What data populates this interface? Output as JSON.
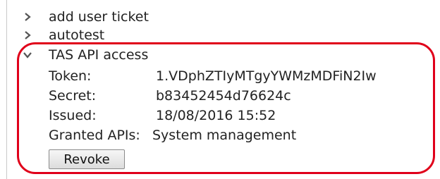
{
  "tree": {
    "items": [
      {
        "label": "add user ticket",
        "expanded": false,
        "icon": "chevron-right-icon"
      },
      {
        "label": "autotest",
        "expanded": false,
        "icon": "chevron-right-icon"
      },
      {
        "label": "TAS API access",
        "expanded": true,
        "icon": "chevron-down-icon"
      }
    ]
  },
  "details": {
    "token_label": "Token:",
    "token_value": "1.VDphZTIyMTgyYWMzMDFiN2Iw",
    "secret_label": "Secret:",
    "secret_value": "b83452454d76624c",
    "issued_label": "Issued:",
    "issued_value": "18/08/2016 15:52",
    "granted_label": "Granted APIs:",
    "granted_value": "System management",
    "revoke_label": "Revoke"
  },
  "colors": {
    "highlight": "#e0001a",
    "text": "#222222",
    "border": "#c9c9c9"
  }
}
